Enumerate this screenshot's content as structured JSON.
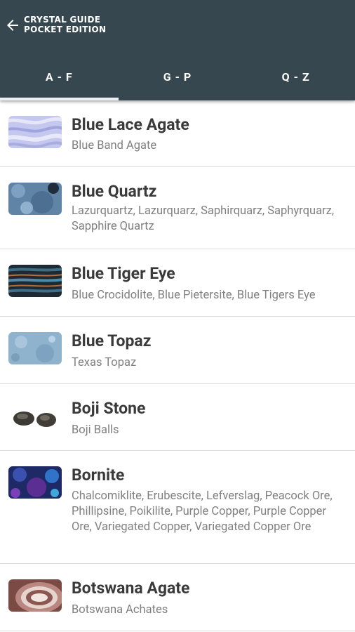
{
  "header": {
    "title_line1": "CRYSTAL GUIDE",
    "title_line2": "POCKET EDITION",
    "back_icon": "arrow-left-icon",
    "background_color": "#37474f"
  },
  "tabs": [
    {
      "label": "A - F",
      "selected": true
    },
    {
      "label": "G - P",
      "selected": false
    },
    {
      "label": "Q - Z",
      "selected": false
    }
  ],
  "crystals": [
    {
      "name": "Blue Lace Agate",
      "aliases": "Blue Band Agate"
    },
    {
      "name": "Blue Quartz",
      "aliases": "Lazurquartz, Lazurquarz, Saphirquarz, Saphyrquarz, Sapphire Quartz"
    },
    {
      "name": "Blue Tiger Eye",
      "aliases": "Blue Crocidolite, Blue Pietersite, Blue Tigers Eye"
    },
    {
      "name": "Blue Topaz",
      "aliases": "Texas Topaz"
    },
    {
      "name": "Boji Stone",
      "aliases": "Boji Balls"
    },
    {
      "name": "Bornite",
      "aliases": "Chalcomiklite, Erubescite, Lefverslag, Peacock Ore, Phillipsine, Poikilite, Purple Copper, Purple Copper Ore, Variegated Copper, Variegated Copper Ore"
    },
    {
      "name": "Botswana Agate",
      "aliases": "Botswana Achates"
    }
  ]
}
